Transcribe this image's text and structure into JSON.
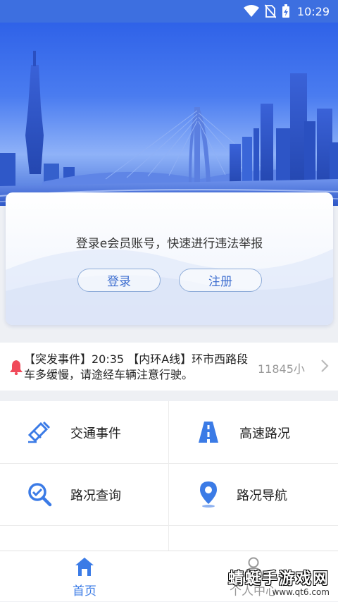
{
  "status_bar": {
    "time": "10:29"
  },
  "login_card": {
    "message": "登录e会员账号，快速进行违法举报",
    "login_label": "登录",
    "register_label": "注册"
  },
  "notice": {
    "text": "【突发事件】20:35 【内环A线】环市西路段车多缓慢，请途经车辆注意行驶。",
    "count": "11845小"
  },
  "services": [
    {
      "label": "交通事件",
      "icon": "traffic-incident-icon"
    },
    {
      "label": "高速路况",
      "icon": "highway-icon"
    },
    {
      "label": "路况查询",
      "icon": "search-check-icon"
    },
    {
      "label": "路况导航",
      "icon": "location-pin-icon"
    }
  ],
  "tabs": [
    {
      "label": "首页",
      "icon": "home-icon",
      "active": true
    },
    {
      "label": "个人中心",
      "icon": "person-icon",
      "active": false
    }
  ],
  "watermark": {
    "title": "蜻蜓手游戏网",
    "url": "www.qt6.com"
  },
  "colors": {
    "accent": "#3d6fe0",
    "icon_blue": "#3b7be6",
    "alert_red": "#f04a5a"
  }
}
